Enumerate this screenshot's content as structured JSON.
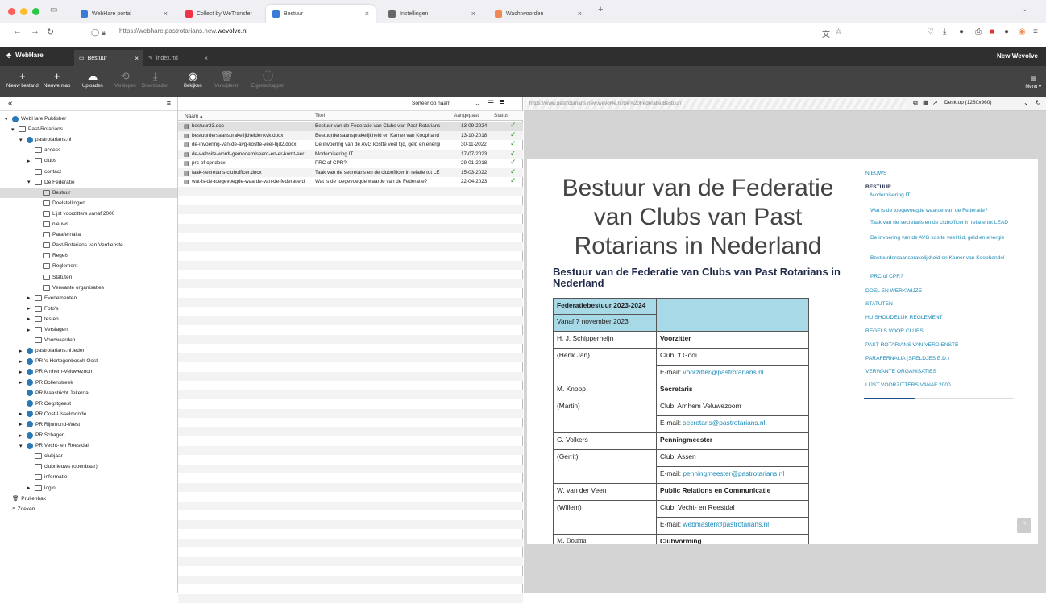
{
  "browser": {
    "tabs": [
      {
        "label": "WebHare portal",
        "color": "#3a7bd5"
      },
      {
        "label": "Collect by WeTransfer",
        "color": "#e34"
      },
      {
        "label": "Bestuur",
        "color": "#3a7bd5"
      },
      {
        "label": "Instellingen",
        "color": "#666"
      },
      {
        "label": "Wachtwoorden",
        "color": "#e85"
      }
    ],
    "url_prefix": "https://webhare.pastrotarians.new.",
    "url_domain": "wevolve.nl"
  },
  "app": {
    "name": "WebHare",
    "tabs": [
      "Bestuur",
      "index.rtd"
    ],
    "org": "New Wevolve",
    "menu_label": "Menu ▾"
  },
  "toolbar": {
    "buttons": [
      {
        "label": "Nieuw bestand",
        "icon": "+",
        "disabled": false
      },
      {
        "label": "Nieuwe map",
        "icon": "+",
        "disabled": false
      },
      {
        "label": "Uploaden",
        "icon": "☁",
        "disabled": false
      },
      {
        "label": "Verslepen",
        "icon": "⟲",
        "disabled": true
      },
      {
        "label": "Downloaden",
        "icon": "⤓",
        "disabled": true
      },
      {
        "label": "Bekijken",
        "icon": "◉",
        "disabled": false
      },
      {
        "label": "Verwijderen",
        "icon": "🗑",
        "disabled": true
      },
      {
        "label": "Eigenschappen",
        "icon": "ⓘ",
        "disabled": true
      }
    ]
  },
  "tree": {
    "items": [
      {
        "label": "WebHare Publisher",
        "depth": 0,
        "type": "globe",
        "arrow": "▾"
      },
      {
        "label": "Past-Rotarians",
        "depth": 1,
        "type": "folder",
        "arrow": "▾"
      },
      {
        "label": "pastrotarians.nl",
        "depth": 2,
        "type": "globe",
        "arrow": "▾"
      },
      {
        "label": "access",
        "depth": 3,
        "type": "folder",
        "arrow": ""
      },
      {
        "label": "clubs",
        "depth": 3,
        "type": "folder",
        "arrow": "▸"
      },
      {
        "label": "contact",
        "depth": 3,
        "type": "folder",
        "arrow": ""
      },
      {
        "label": "De Federatie",
        "depth": 3,
        "type": "folder",
        "arrow": "▾"
      },
      {
        "label": "Bestuur",
        "depth": 4,
        "type": "folder",
        "arrow": "",
        "selected": true
      },
      {
        "label": "Doelstellingen",
        "depth": 4,
        "type": "folder",
        "arrow": ""
      },
      {
        "label": "Lijst voorzitters vanaf 2000",
        "depth": 4,
        "type": "folder",
        "arrow": ""
      },
      {
        "label": "nieuws",
        "depth": 4,
        "type": "folder",
        "arrow": ""
      },
      {
        "label": "Parafernalia",
        "depth": 4,
        "type": "folder",
        "arrow": ""
      },
      {
        "label": "Past-Rotarians van Verdienste",
        "depth": 4,
        "type": "folder",
        "arrow": ""
      },
      {
        "label": "Regels",
        "depth": 4,
        "type": "folder",
        "arrow": ""
      },
      {
        "label": "Reglement",
        "depth": 4,
        "type": "folder",
        "arrow": ""
      },
      {
        "label": "Statuten",
        "depth": 4,
        "type": "folder",
        "arrow": ""
      },
      {
        "label": "Verwante organisaties",
        "depth": 4,
        "type": "folder",
        "arrow": ""
      },
      {
        "label": "Evenementen",
        "depth": 3,
        "type": "folder",
        "arrow": "▸"
      },
      {
        "label": "Foto's",
        "depth": 3,
        "type": "folder",
        "arrow": "▸"
      },
      {
        "label": "testen",
        "depth": 3,
        "type": "folder",
        "arrow": "▸"
      },
      {
        "label": "Verslagen",
        "depth": 3,
        "type": "folder",
        "arrow": "▸"
      },
      {
        "label": "Voorwaarden",
        "depth": 3,
        "type": "folder",
        "arrow": ""
      },
      {
        "label": "pastrotarians.nl.leden",
        "depth": 2,
        "type": "globe",
        "arrow": "▸"
      },
      {
        "label": "PR 's-Hertogenbosch Oost",
        "depth": 2,
        "type": "globe",
        "arrow": "▸"
      },
      {
        "label": "PR Arnhem-Veluwezoom",
        "depth": 2,
        "type": "globe",
        "arrow": "▸"
      },
      {
        "label": "PR Bollenstreek",
        "depth": 2,
        "type": "globe",
        "arrow": "▸"
      },
      {
        "label": "PR Maastricht Jekerdal",
        "depth": 2,
        "type": "globe",
        "arrow": ""
      },
      {
        "label": "PR Oegstgeest",
        "depth": 2,
        "type": "globe",
        "arrow": ""
      },
      {
        "label": "PR Oost-IJsselmonde",
        "depth": 2,
        "type": "globe",
        "arrow": "▸"
      },
      {
        "label": "PR Rijnmond-West",
        "depth": 2,
        "type": "globe",
        "arrow": "▸"
      },
      {
        "label": "PR Schagen",
        "depth": 2,
        "type": "globe",
        "arrow": "▸"
      },
      {
        "label": "PR Vecht- en Reestdal",
        "depth": 2,
        "type": "globe",
        "arrow": "▾"
      },
      {
        "label": "clubjaar",
        "depth": 3,
        "type": "folder",
        "arrow": ""
      },
      {
        "label": "clubnieuws (openbaar)",
        "depth": 3,
        "type": "folder",
        "arrow": ""
      },
      {
        "label": "informatie",
        "depth": 3,
        "type": "folder",
        "arrow": ""
      },
      {
        "label": "login",
        "depth": 3,
        "type": "folder",
        "arrow": "▸"
      },
      {
        "label": "Prullenbak",
        "depth": 0,
        "type": "trash",
        "arrow": ""
      },
      {
        "label": "Zoeken",
        "depth": 0,
        "type": "search",
        "arrow": ""
      }
    ]
  },
  "list": {
    "sort_label": "Sorteer op naam",
    "columns": [
      "Naam ▴",
      "Titel",
      "Aangepast",
      "Status"
    ],
    "rows": [
      {
        "name": "bestuur33.doc",
        "title": "Bestuur van de Federatie van Clubs van Past Rotarians",
        "date": "13-09-2024"
      },
      {
        "name": "bestuurdersaansprakelijkheidenkvk.docx",
        "title": "Bestuurdersaansprakelijkheid en Kamer van Koophand",
        "date": "13-10-2018"
      },
      {
        "name": "de-invoering-van-de-avg-kostte-veel-tijd2.docx",
        "title": "De invoering van de AVG kostte veel tijd, geld en energi",
        "date": "30-11-2022"
      },
      {
        "name": "de-website-wordt-gemoderniseerd-en-er-komt-eer",
        "title": "Modernisering IT",
        "date": "17-07-2023"
      },
      {
        "name": "prc-of-cpr.docx",
        "title": "PRC of CPR?",
        "date": "29-01-2018"
      },
      {
        "name": "taak-secretaris-clubofficer.docx",
        "title": "Taak van de secretaris en de clubofficer in relatie tot LE",
        "date": "15-03-2022"
      },
      {
        "name": "wat-is-de-toegevoegde-waarde-van-de-federatie.d",
        "title": "Wat is de toegevoegde waarde van de Federatie?",
        "date": "22-04-2023"
      }
    ]
  },
  "preview": {
    "url": "https://www.pastrotarians.new.wevolve.nl/De%20Federatie/Bestuur/",
    "device": "Desktop (1280x960)",
    "title": "Bestuur van de Federatie van Clubs van Past Rotarians in Nederland",
    "heading": "Bestuur van de Federatie van Clubs van Past Rotarians in Nederland",
    "table": {
      "head1": "Federatiebestuur 2023-2024",
      "head2": "Vanaf 7 november 2023",
      "members": [
        {
          "name": "H. J. Schipperheijn",
          "nick": "(Henk Jan)",
          "role": "Voorzitter",
          "club": "Club: 't Gooi",
          "email_label": "E-mail: ",
          "email": "voorzitter@pastrotarians.nl"
        },
        {
          "name": "M. Knoop",
          "nick": "(Martin)",
          "role": "Secretaris",
          "club": "Club: Arnhem Veluwezoom",
          "email_label": "E-mail: ",
          "email": "secretaris@pastrotarians.nl"
        },
        {
          "name": "G. Volkers",
          "nick": "(Gerrit)",
          "role": "Penningmeester",
          "club": "Club: Assen",
          "email_label": "E-mail: ",
          "email": "penningmeester@pastrotarians.nl"
        },
        {
          "name": "W. van der Veen",
          "nick": "(Willem)",
          "role": "Public Relations en Communicatie",
          "club": "Club: Vecht- en Reestdal",
          "email_label": "E-mail: ",
          "email": "webmaster@pastrotarians.nl"
        }
      ],
      "last_name": "M. Douma",
      "last_role": "Clubvorming"
    },
    "nav": [
      {
        "label": "NIEUWS",
        "sub": false,
        "bold": false
      },
      {
        "label": "BESTUUR",
        "sub": false,
        "bold": true
      },
      {
        "label": "Modernisering IT",
        "sub": true
      },
      {
        "label": "Wat is de toegevoegde waarde van de Federatie?",
        "sub": true
      },
      {
        "label": "Taak van de secretaris en de clubofficer in relatie tot LEAD",
        "sub": true
      },
      {
        "label": "De invoering van de AVG kostte veel tijd, geld en energie",
        "sub": true
      },
      {
        "label": "Bestuurdersaansprakelijkheid en Kamer van Koophandel",
        "sub": true
      },
      {
        "label": "PRC of CPR?",
        "sub": true
      },
      {
        "label": "DOEL EN WERKWIJZE",
        "sub": false
      },
      {
        "label": "STATUTEN",
        "sub": false
      },
      {
        "label": "HUISHOUDELIJK REGLEMENT",
        "sub": false
      },
      {
        "label": "REGELS VOOR CLUBS",
        "sub": false
      },
      {
        "label": "PAST-ROTARIANS VAN VERDIENSTE",
        "sub": false
      },
      {
        "label": "PARAFERNALIA (SPELDJES E.D.)",
        "sub": false
      },
      {
        "label": "VERWANTE ORGANISATIES",
        "sub": false
      },
      {
        "label": "LIJST VOORZITTERS VANAF 2000",
        "sub": false
      }
    ]
  }
}
